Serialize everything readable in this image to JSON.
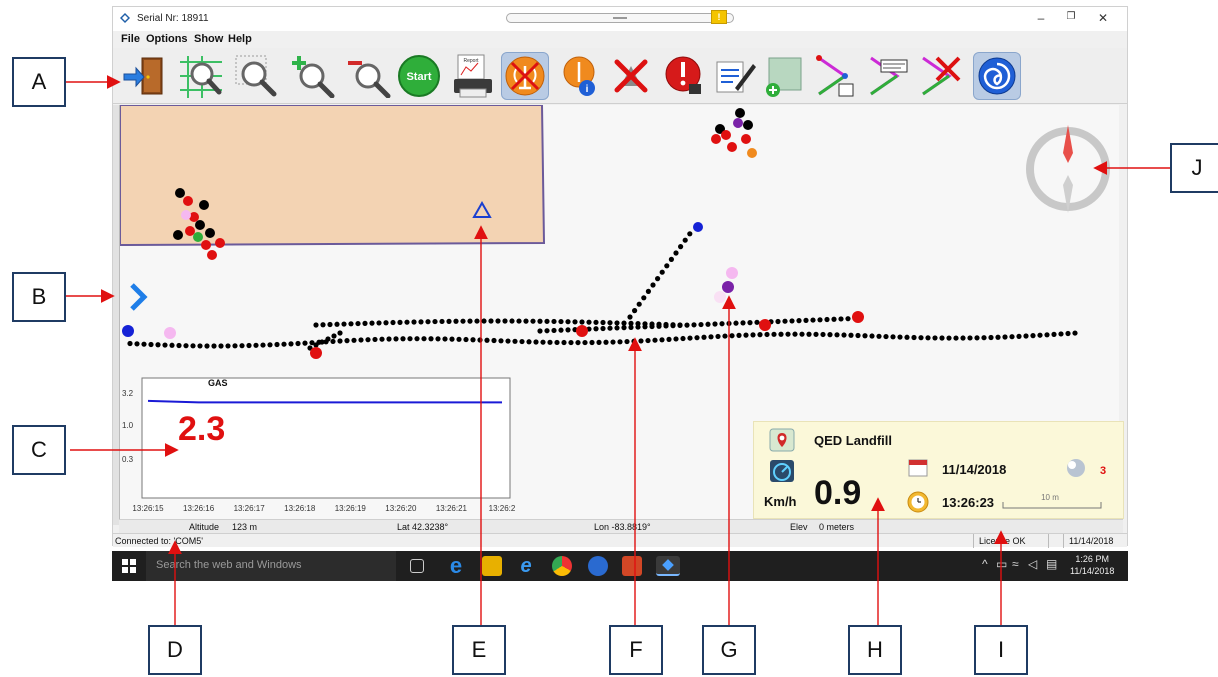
{
  "window": {
    "title": "Serial Nr: 18911",
    "minimize": "–",
    "maximize": "❐",
    "close": "✕"
  },
  "menu": [
    "File",
    "Options",
    "Show",
    "Help"
  ],
  "toolbar": {
    "tools": [
      {
        "name": "exit-door-icon",
        "glyph": "🚪"
      },
      {
        "name": "map-zoom-icon",
        "glyph": "🔍"
      },
      {
        "name": "zoom-select-icon",
        "glyph": "🔍"
      },
      {
        "name": "zoom-in-icon",
        "glyph": "🔍"
      },
      {
        "name": "zoom-out-icon",
        "glyph": "🔍"
      },
      {
        "name": "start-button-icon",
        "glyph": "Start"
      },
      {
        "name": "report-print-icon",
        "glyph": "🖨"
      },
      {
        "name": "signal-off-icon",
        "glyph": "📡"
      },
      {
        "name": "signal-info-icon",
        "glyph": "📡"
      },
      {
        "name": "satellite-off-icon",
        "glyph": "🛰"
      },
      {
        "name": "alarm-icon",
        "glyph": "!"
      },
      {
        "name": "edit-coordinates-icon",
        "glyph": "✍"
      },
      {
        "name": "add-map-icon",
        "glyph": "🗺"
      },
      {
        "name": "path-select-icon",
        "glyph": "◇"
      },
      {
        "name": "path-coordinates-icon",
        "glyph": "◇"
      },
      {
        "name": "path-delete-icon",
        "glyph": "◇"
      },
      {
        "name": "swirl-icon",
        "glyph": "@"
      }
    ],
    "report_label": "Report",
    "start_label": "Start"
  },
  "chart_data": {
    "type": "line",
    "title": "GAS",
    "current_value": "2.3",
    "y_ticks": [
      "3.2",
      "1.0",
      "0.3"
    ],
    "x": [
      "13:26:15",
      "13:26:16",
      "13:26:17",
      "13:26:18",
      "13:26:19",
      "13:26:20",
      "13:26:21",
      "13:26:2"
    ],
    "series": [
      {
        "values": [
          2.9,
          2.85,
          2.85,
          2.85,
          2.85,
          2.85,
          2.85,
          2.85
        ]
      }
    ],
    "ylim": [
      0,
      3.5
    ],
    "line_color": "#1a1ad6"
  },
  "status": {
    "altitude_label": "Altitude",
    "altitude_value": "123 m",
    "lat": "Lat 42.3238°",
    "lon": "Lon -83.8819°",
    "elev_label": "Elev",
    "elev_value": "0 meters"
  },
  "connbar": {
    "connection": "Connected to: 'COM5'",
    "license": "License OK",
    "date": "11/14/2018"
  },
  "info": {
    "site": "QED Landfill",
    "speed_value": "0.9",
    "speed_unit": "Km/h",
    "date": "11/14/2018",
    "time": "13:26:23",
    "satellites": "3",
    "scale": "10 m"
  },
  "taskbar": {
    "search_placeholder": "Search the web and Windows",
    "time": "1:26 PM",
    "date": "11/14/2018"
  },
  "callouts": [
    "A",
    "B",
    "C",
    "D",
    "E",
    "F",
    "G",
    "H",
    "I",
    "J"
  ],
  "colors": {
    "accent_red": "#e01010",
    "callout_border": "#1f3b63",
    "zone_fill": "#f3d3b3",
    "zone_border": "#6b5a9a",
    "info_bg": "#fbf8d9"
  }
}
